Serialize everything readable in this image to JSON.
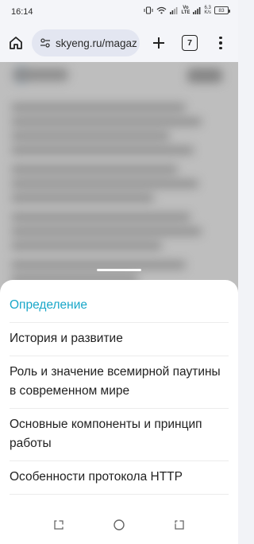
{
  "status_bar": {
    "time": "16:14",
    "volte_top": "Vo",
    "volte_bottom": "LTE",
    "speed_value": "6.3",
    "speed_unit": "K/s",
    "battery": "83"
  },
  "browser": {
    "url": "skyeng.ru/magaz",
    "tab_count": "7",
    "icons": [
      "home-icon",
      "site-settings-icon",
      "plus-icon",
      "tabs-icon",
      "more-vert-icon"
    ]
  },
  "toc": {
    "items": [
      {
        "label": "Определение",
        "active": true
      },
      {
        "label": "История и развитие",
        "active": false
      },
      {
        "label": "Роль и значение всемирной паутины в современном мире",
        "active": false
      },
      {
        "label": "Основные компоненты и принцип работы",
        "active": false
      },
      {
        "label": "Особенности протокола HTTP",
        "active": false
      }
    ],
    "accent_color": "#19a7c9"
  },
  "nav_bar": {
    "icons": [
      "recents-icon",
      "home-circle-icon",
      "back-icon"
    ]
  }
}
